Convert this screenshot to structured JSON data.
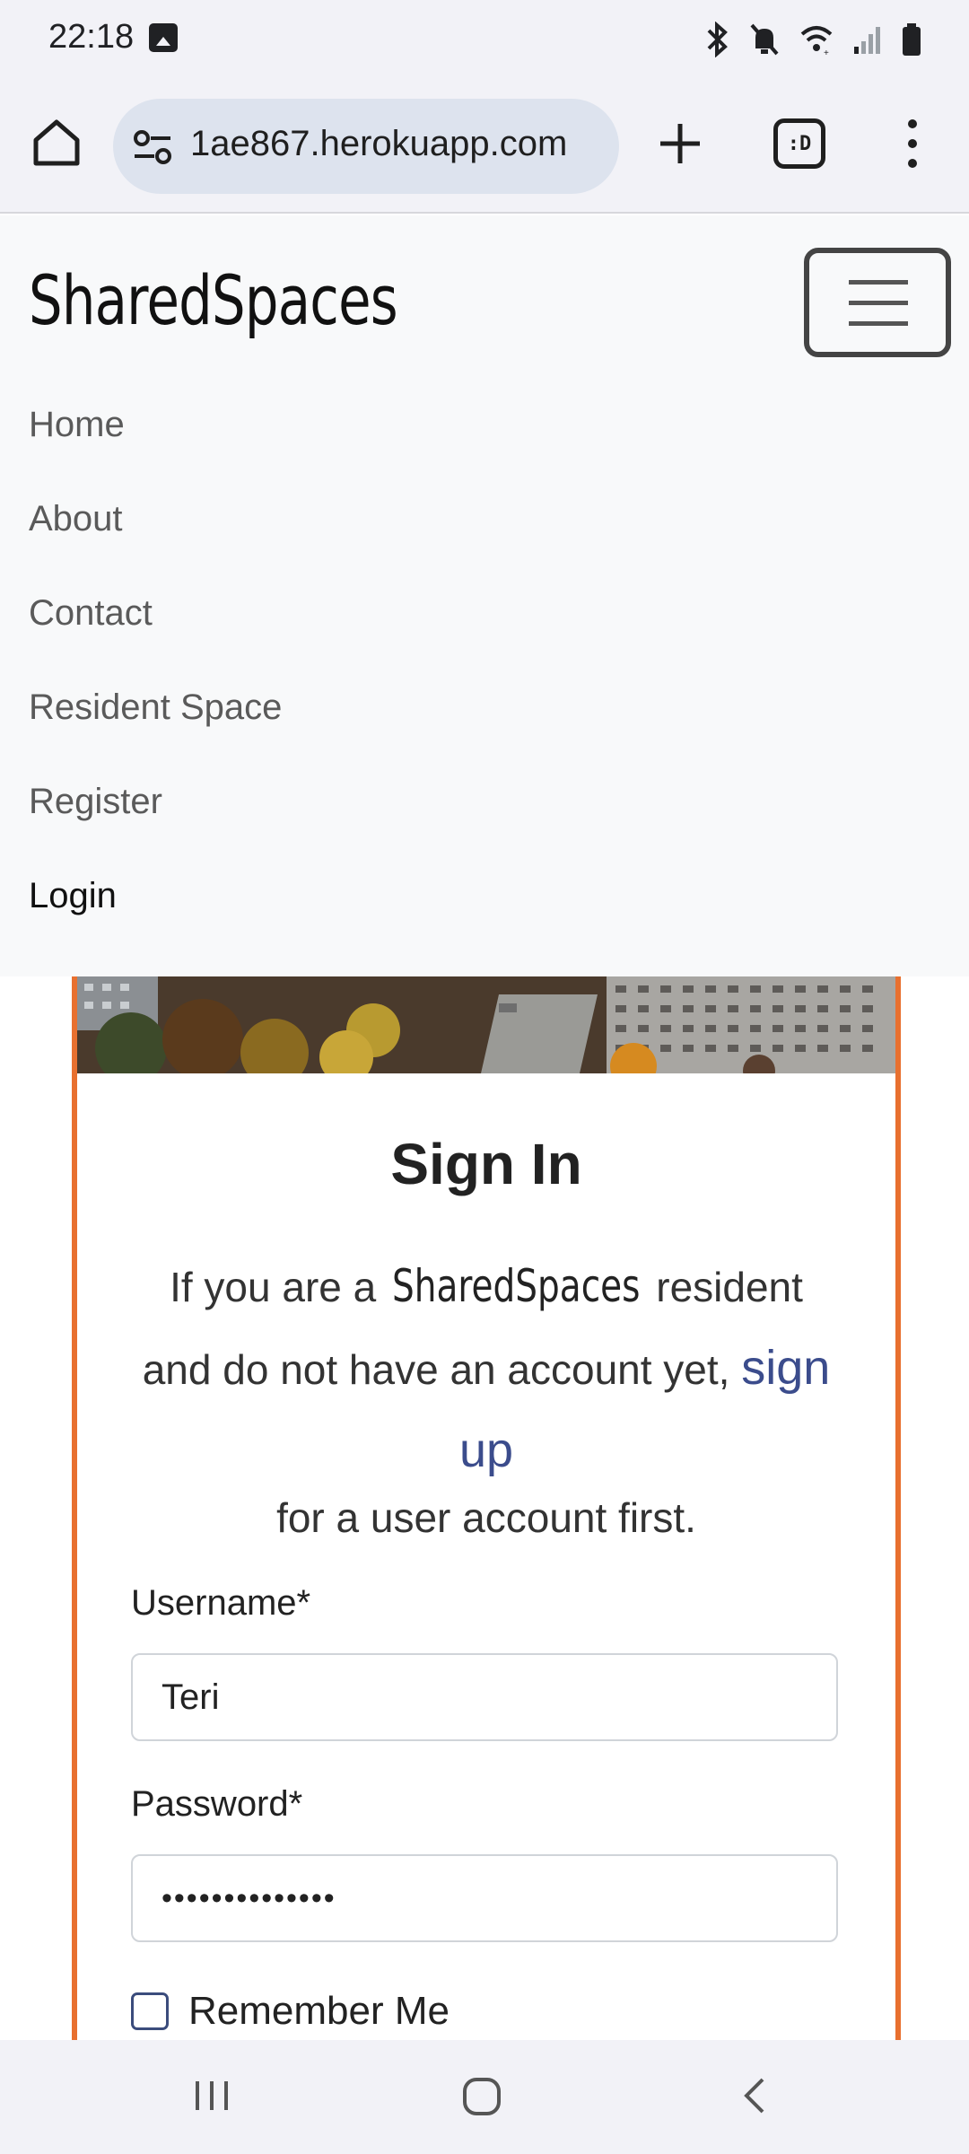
{
  "status_bar": {
    "time": "22:18",
    "icons": [
      "image-icon",
      "bluetooth-icon",
      "mute-icon",
      "wifi-icon",
      "signal-icon",
      "battery-icon"
    ]
  },
  "browser": {
    "url": "1ae867.herokuapp.com",
    "tab_count": ":D",
    "icons": [
      "home-icon",
      "site-settings-icon",
      "new-tab-icon",
      "tab-switcher-icon",
      "more-menu-icon"
    ]
  },
  "site": {
    "brand": "SharedSpaces",
    "nav_items": [
      {
        "label": "Home",
        "active": false
      },
      {
        "label": "About",
        "active": false
      },
      {
        "label": "Contact",
        "active": false
      },
      {
        "label": "Resident Space",
        "active": false
      },
      {
        "label": "Register",
        "active": false
      },
      {
        "label": "Login",
        "active": true
      }
    ]
  },
  "signin": {
    "title": "Sign In",
    "intro_prefix": "If you are a",
    "intro_brand": "SharedSpaces",
    "intro_mid": "resident and do not have an account yet,",
    "signup_link": "sign up",
    "intro_suffix": "for a user account first.",
    "username_label": "Username*",
    "username_value": "Teri",
    "password_label": "Password*",
    "password_value": "••••••••••••••",
    "remember_label": "Remember Me",
    "remember_checked": false
  },
  "colors": {
    "card_border": "#e8702f",
    "link": "#3b4c8c",
    "nav_bg": "#f8f9fa"
  },
  "system_nav": [
    "recents-icon",
    "home-circle-icon",
    "back-icon"
  ]
}
